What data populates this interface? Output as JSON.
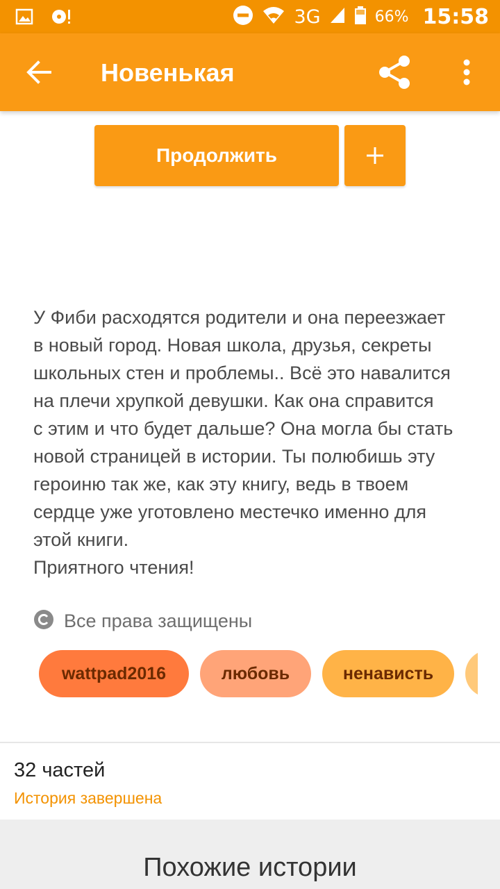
{
  "status_bar": {
    "network": "3G",
    "battery": "66%",
    "time": "15:58"
  },
  "appbar": {
    "title": "Новенькая"
  },
  "actions": {
    "continue_label": "Продолжить",
    "add_label": "+"
  },
  "story": {
    "description": "У Фиби расходятся родители и она переезжает\nв новый город. Новая школа, друзья, секреты\nшкольных стен и проблемы.. Всё это навалится\nна плечи хрупкой девушки. Как она справится\nс этим и что будет дальше? Она могла бы стать\nновой страницей в истории. Ты полюбишь эту\nгероиню так же, как эту книгу, ведь в твоем\nсердце уже уготовлено местечко именно для\nэтой книги.\nПриятного чтения!",
    "copyright_label": "Все права защищены",
    "tags": [
      "wattpad2016",
      "любовь",
      "ненависть",
      ""
    ],
    "parts_label": "32 частей",
    "status_label": "История завершена"
  },
  "similar": {
    "title": "Похожие истории"
  },
  "colors": {
    "status_bar": "#f39200",
    "appbar": "#fa9a14",
    "accent": "#f39200",
    "tag_1": "#ff7a3d",
    "tag_2": "#ffa478",
    "tag_3": "#ffb347"
  }
}
